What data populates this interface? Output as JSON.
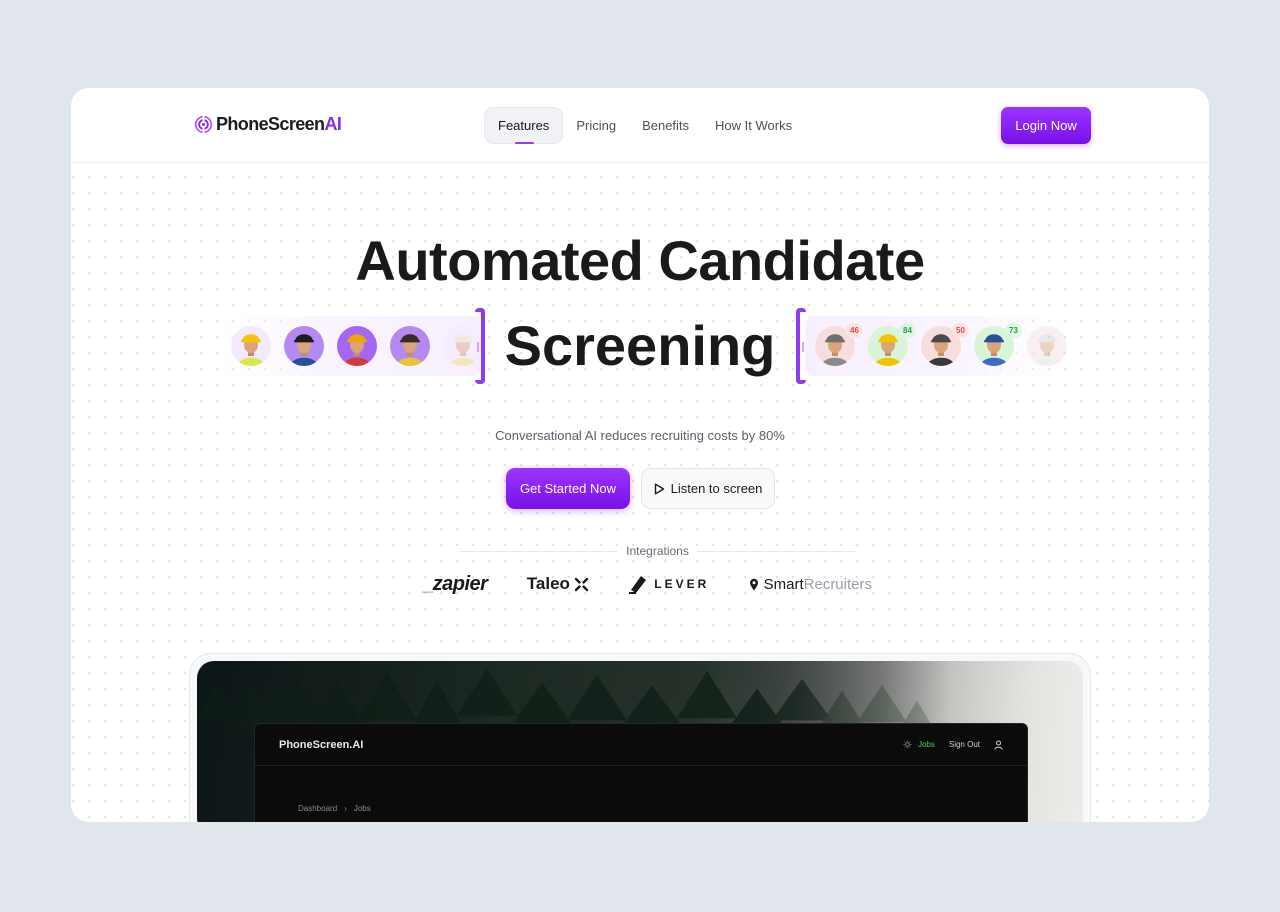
{
  "brand": {
    "name_main": "PhoneScreen",
    "name_accent": "AI",
    "accent_color": "#8a2be2"
  },
  "nav": {
    "links": [
      {
        "label": "Features",
        "active": true
      },
      {
        "label": "Pricing",
        "active": false
      },
      {
        "label": "Benefits",
        "active": false
      },
      {
        "label": "How It Works",
        "active": false
      }
    ],
    "login_label": "Login Now"
  },
  "hero": {
    "headline_line1": "Automated Candidate",
    "headline_line2": "Screening",
    "subtitle": "Conversational AI reduces recruiting costs by 80%",
    "cta_primary": "Get Started Now",
    "cta_secondary": "Listen to screen",
    "integrations_label": "Integrations"
  },
  "candidates_left": [
    {
      "bg": "#f3eaff",
      "hat": "#f5c400",
      "shirt": "#d9e84a"
    },
    {
      "bg": "#b58af0",
      "hat": "#1c1c1c",
      "shirt": "#2a4f9c"
    },
    {
      "bg": "#a467f2",
      "hat": "#f0a400",
      "shirt": "#d23a3a"
    },
    {
      "bg": "#b58af0",
      "hat": "#3a2b22",
      "shirt": "#e8c43a"
    },
    {
      "bg": "#f3eaff",
      "hat": "#f0e2b8",
      "shirt": "#f3d77a"
    }
  ],
  "candidates_right": [
    {
      "bg": "#f6dede",
      "hat": "#6f6f6f",
      "shirt": "#8a8a8a",
      "score": "46",
      "tone": "red"
    },
    {
      "bg": "#d8f5d8",
      "hat": "#f5c400",
      "shirt": "#f0c400",
      "score": "84",
      "tone": "green"
    },
    {
      "bg": "#f6dede",
      "hat": "#4a4a4a",
      "shirt": "#3a3a3a",
      "score": "50",
      "tone": "red"
    },
    {
      "bg": "#d8f5d8",
      "hat": "#2a4f9c",
      "shirt": "#3b6bc2",
      "score": "73",
      "tone": "green"
    },
    {
      "bg": "#f6dede",
      "hat": "#cfcfcf",
      "shirt": "#e0e0e0",
      "score": "",
      "tone": "none"
    }
  ],
  "integrations": [
    {
      "name": "zapier",
      "prefix": "_",
      "label": "zapier"
    },
    {
      "name": "taleo",
      "label": "Taleo"
    },
    {
      "name": "lever",
      "label": "LEVER"
    },
    {
      "name": "smartrecruiters",
      "label_main": "Smart",
      "label_rest": "Recruiters"
    }
  ],
  "preview": {
    "app_title": "PhoneScreen.AI",
    "nav_jobs": "Jobs",
    "nav_signout": "Sign Out",
    "breadcrumb_root": "Dashboard",
    "breadcrumb_separator": "›",
    "breadcrumb_current": "Jobs"
  }
}
